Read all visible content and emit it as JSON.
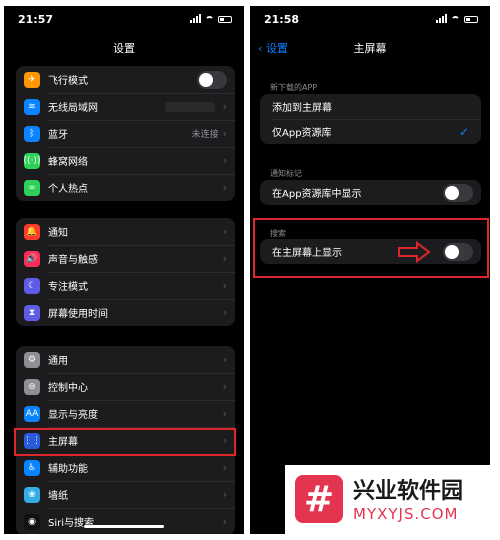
{
  "left": {
    "status_time": "21:57",
    "title": "设置",
    "group1": [
      {
        "label": "飞行模式",
        "icon": "airplane-icon",
        "color": "#ff9500",
        "glyph": "✈",
        "accessory": "toggle"
      },
      {
        "label": "无线局域网",
        "icon": "wifi-icon",
        "color": "#0a84ff",
        "glyph": "≋",
        "accessory": "value-hidden"
      },
      {
        "label": "蓝牙",
        "icon": "bluetooth-icon",
        "color": "#0a84ff",
        "glyph": "ᛒ",
        "value": "未连接",
        "accessory": "chevron"
      },
      {
        "label": "蜂窝网络",
        "icon": "cellular-icon",
        "color": "#30d158",
        "glyph": "((·))",
        "accessory": "chevron"
      },
      {
        "label": "个人热点",
        "icon": "hotspot-icon",
        "color": "#30d158",
        "glyph": "∞",
        "accessory": "chevron"
      }
    ],
    "group2": [
      {
        "label": "通知",
        "icon": "notifications-icon",
        "color": "#ff3b30",
        "glyph": "🔔",
        "accessory": "chevron"
      },
      {
        "label": "声音与触感",
        "icon": "sounds-icon",
        "color": "#ff2d55",
        "glyph": "🔊",
        "accessory": "chevron"
      },
      {
        "label": "专注模式",
        "icon": "focus-icon",
        "color": "#5e5ce6",
        "glyph": "☾",
        "accessory": "chevron"
      },
      {
        "label": "屏幕使用时间",
        "icon": "screen-time-icon",
        "color": "#5e5ce6",
        "glyph": "⧗",
        "accessory": "chevron"
      }
    ],
    "group3": [
      {
        "label": "通用",
        "icon": "general-icon",
        "color": "#8e8e93",
        "glyph": "⚙",
        "accessory": "chevron"
      },
      {
        "label": "控制中心",
        "icon": "control-center-icon",
        "color": "#8e8e93",
        "glyph": "⊜",
        "accessory": "chevron"
      },
      {
        "label": "显示与亮度",
        "icon": "display-icon",
        "color": "#0a84ff",
        "glyph": "AA",
        "accessory": "chevron"
      },
      {
        "label": "主屏幕",
        "icon": "home-screen-icon",
        "color": "#2c5bd9",
        "glyph": "⋮⋮",
        "accessory": "chevron"
      },
      {
        "label": "辅助功能",
        "icon": "accessibility-icon",
        "color": "#0a84ff",
        "glyph": "♿",
        "accessory": "chevron"
      },
      {
        "label": "墙纸",
        "icon": "wallpaper-icon",
        "color": "#32ade6",
        "glyph": "❀",
        "accessory": "chevron"
      },
      {
        "label": "Siri与搜索",
        "icon": "siri-icon",
        "color": "#111111",
        "glyph": "◉",
        "accessory": "chevron"
      }
    ]
  },
  "right": {
    "status_time": "21:58",
    "back_label": "设置",
    "title": "主屏幕",
    "section_new_apps": "新下载的APP",
    "option_add": "添加到主屏幕",
    "option_library": "仅App资源库",
    "section_badges": "通知标记",
    "badges_label": "在App资源库中显示",
    "section_search": "搜索",
    "search_label": "在主屏幕上显示"
  },
  "watermark": {
    "logo_glyph": "#",
    "name": "兴业软件园",
    "url": "MYXYJS.COM"
  },
  "colors": {
    "highlight": "#e0262b",
    "accent": "#0a84ff"
  }
}
